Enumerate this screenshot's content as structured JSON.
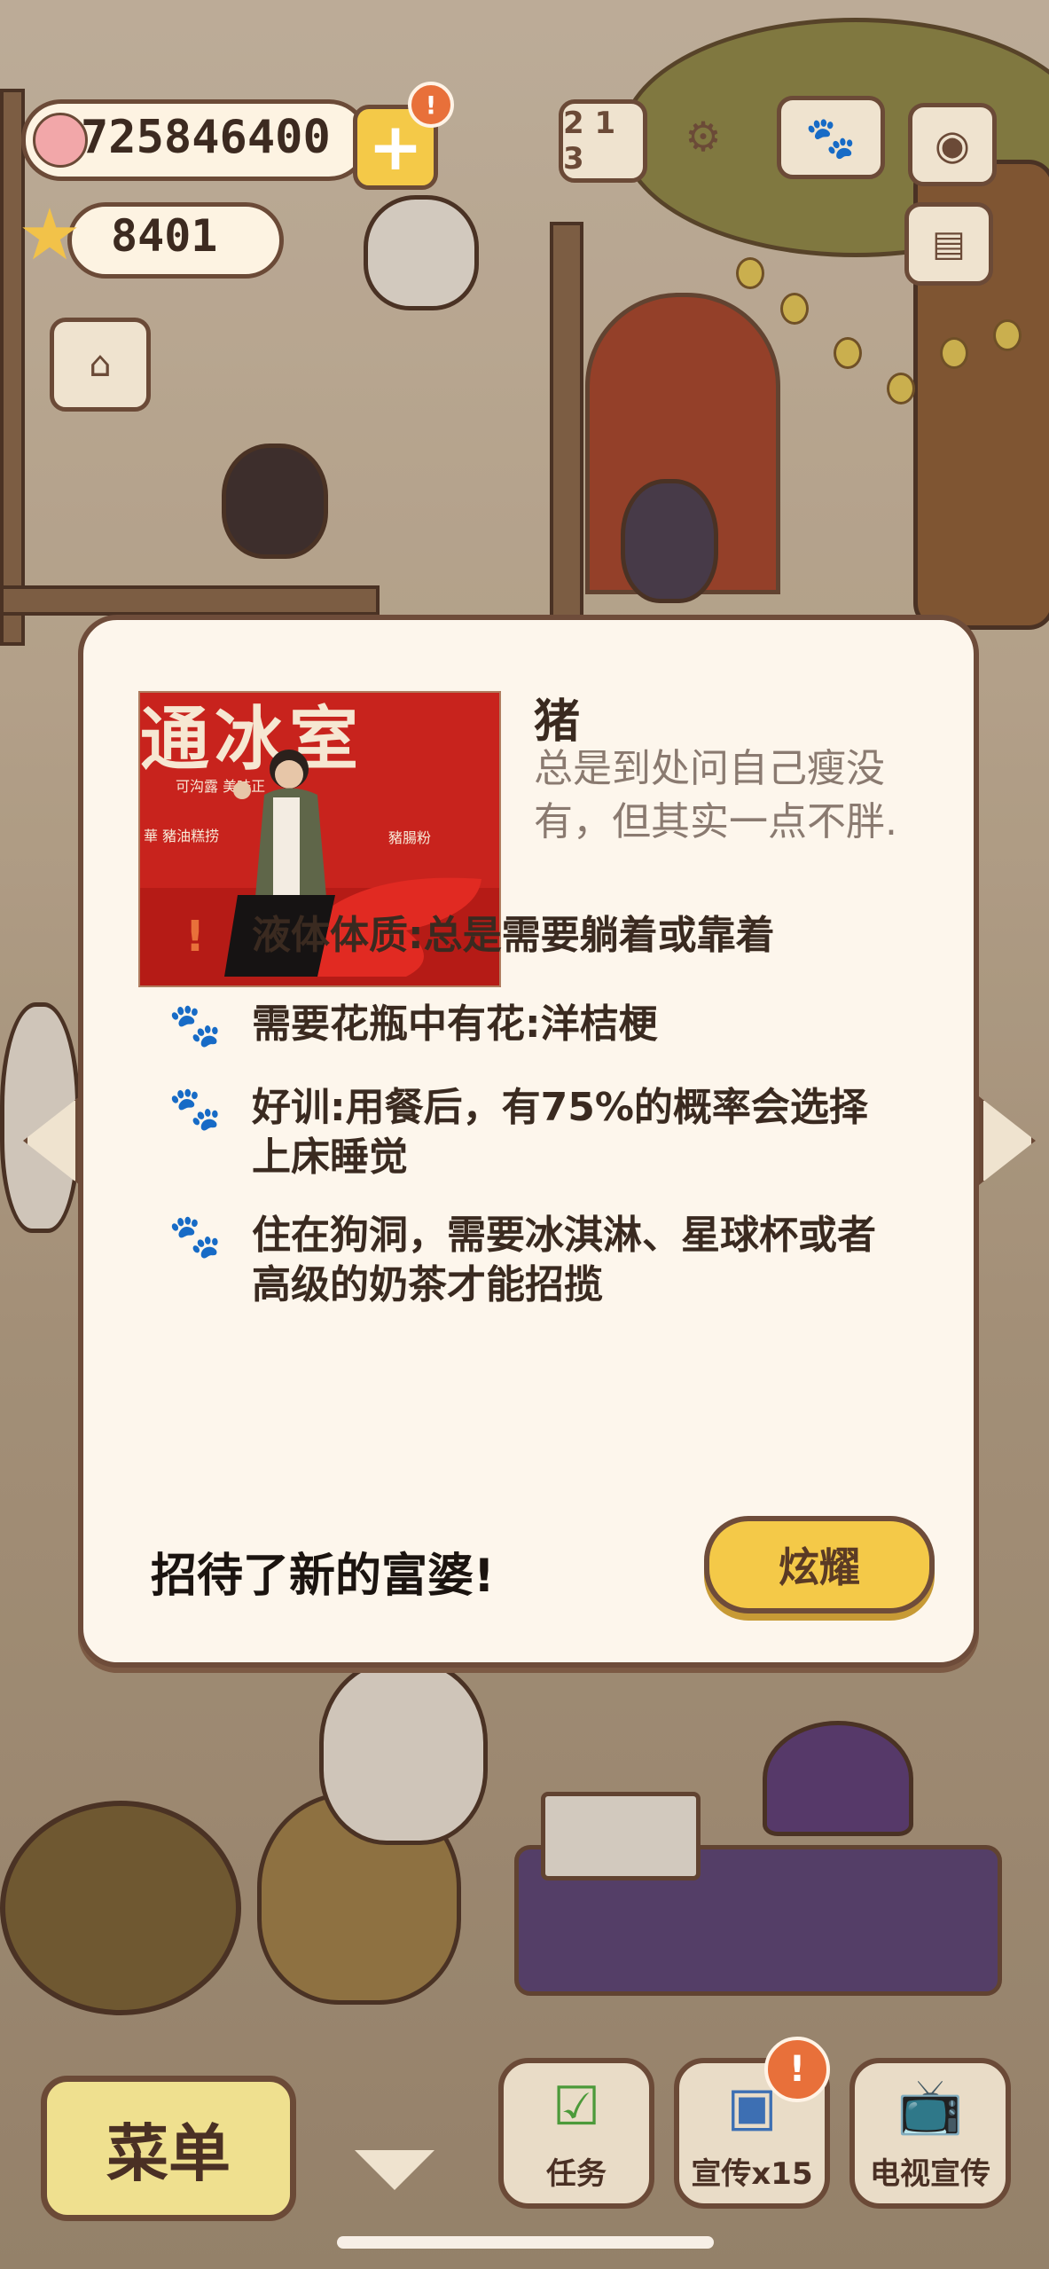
{
  "hud": {
    "coins": "725846400",
    "coin_icon": "pig-face-icon",
    "add_coins_badge": "!",
    "stars": "8401",
    "star_icon": "star-face-icon",
    "icons": [
      "ranking-podium-icon",
      "settings-gear-icon",
      "paw-book-icon",
      "camera-icon",
      "newspaper-icon",
      "shop-stall-icon"
    ]
  },
  "dialog": {
    "photo": {
      "sign_text": "通冰室",
      "sign_sub_1": "可沟露  美味正",
      "sign_sub_2": "華  豬油糕捞",
      "sign_sub_3": "豬腸粉"
    },
    "character_name": "猪",
    "character_desc": "总是到处问自己瘦没有，但其实一点不胖.",
    "traits": [
      {
        "icon": "exclamation-icon",
        "text": "液体体质:总是需要躺着或靠着"
      },
      {
        "icon": "paw-icon",
        "text": "需要花瓶中有花:洋桔梗"
      },
      {
        "icon": "paw-icon",
        "text": "好训:用餐后，有75%的概率会选择上床睡觉"
      },
      {
        "icon": "paw-icon",
        "text": "住在狗洞，需要冰淇淋、星球杯或者高级的奶茶才能招揽"
      }
    ],
    "new_customer_msg": "招待了新的富婆!",
    "show_off_label": "炫耀"
  },
  "bottom": {
    "menu_label": "菜单",
    "tasks_label": "任务",
    "promo_label": "宣传x15",
    "tv_promo_label": "电视宣传",
    "promo_badge": "!"
  },
  "colors": {
    "panel_bg": "#fdf6ec",
    "border_brown": "#6e4c3a",
    "button_yellow": "#f4c948",
    "alert_orange": "#e8703a",
    "photo_red": "#c8231d"
  }
}
